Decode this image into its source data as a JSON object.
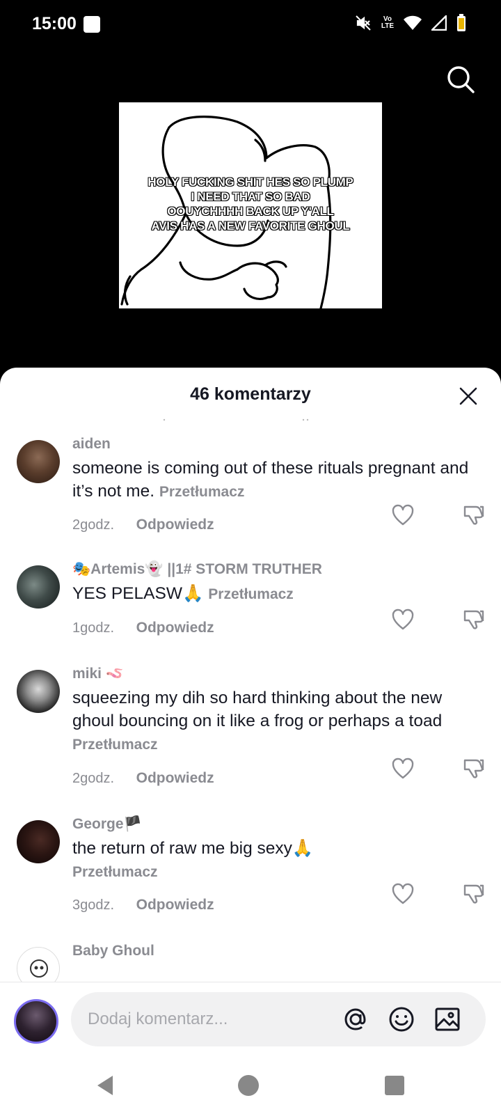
{
  "status_bar": {
    "time": "15:00",
    "network_label_top": "Vo",
    "network_label_bottom": "LTE"
  },
  "video": {
    "caption_lines": [
      "HOLY FUCKING SHIT HES SO PLUMP",
      "I NEED THAT SO BAD",
      "OOUYCHHHH BACK UP Y'ALL",
      "AVIS HAS A NEW FAVORITE GHOUL"
    ]
  },
  "sheet": {
    "title": "46 komentarzy"
  },
  "comments": [
    {
      "username": "aiden",
      "text": "someone is coming out of these rituals pregnant and it’s not me.",
      "translate": "Przetłumacz",
      "time": "2godz.",
      "reply": "Odpowiedz"
    },
    {
      "username": "🎭Artemis👻 ||1# STORM TRUTHER",
      "text": "YES PELASW🙏",
      "translate": "Przetłumacz",
      "time": "1godz.",
      "reply": "Odpowiedz"
    },
    {
      "username": "miki 🪱",
      "text": "squeezing my dih so hard thinking about the new ghoul bouncing on it like a frog or perhaps a toad",
      "translate": "Przetłumacz",
      "time": "2godz.",
      "reply": "Odpowiedz"
    },
    {
      "username": "George🏴",
      "text": "the return of raw me big sexy🙏",
      "translate": "Przetłumacz",
      "time": "3godz.",
      "reply": "Odpowiedz"
    },
    {
      "username": "Baby Ghoul"
    }
  ],
  "composer": {
    "placeholder": "Dodaj komentarz..."
  },
  "icons": {
    "search": "search-icon",
    "close": "close-icon",
    "like": "heart-icon",
    "dislike": "thumbs-down-icon",
    "mention": "at-icon",
    "emoji": "emoji-icon",
    "image": "image-icon"
  }
}
